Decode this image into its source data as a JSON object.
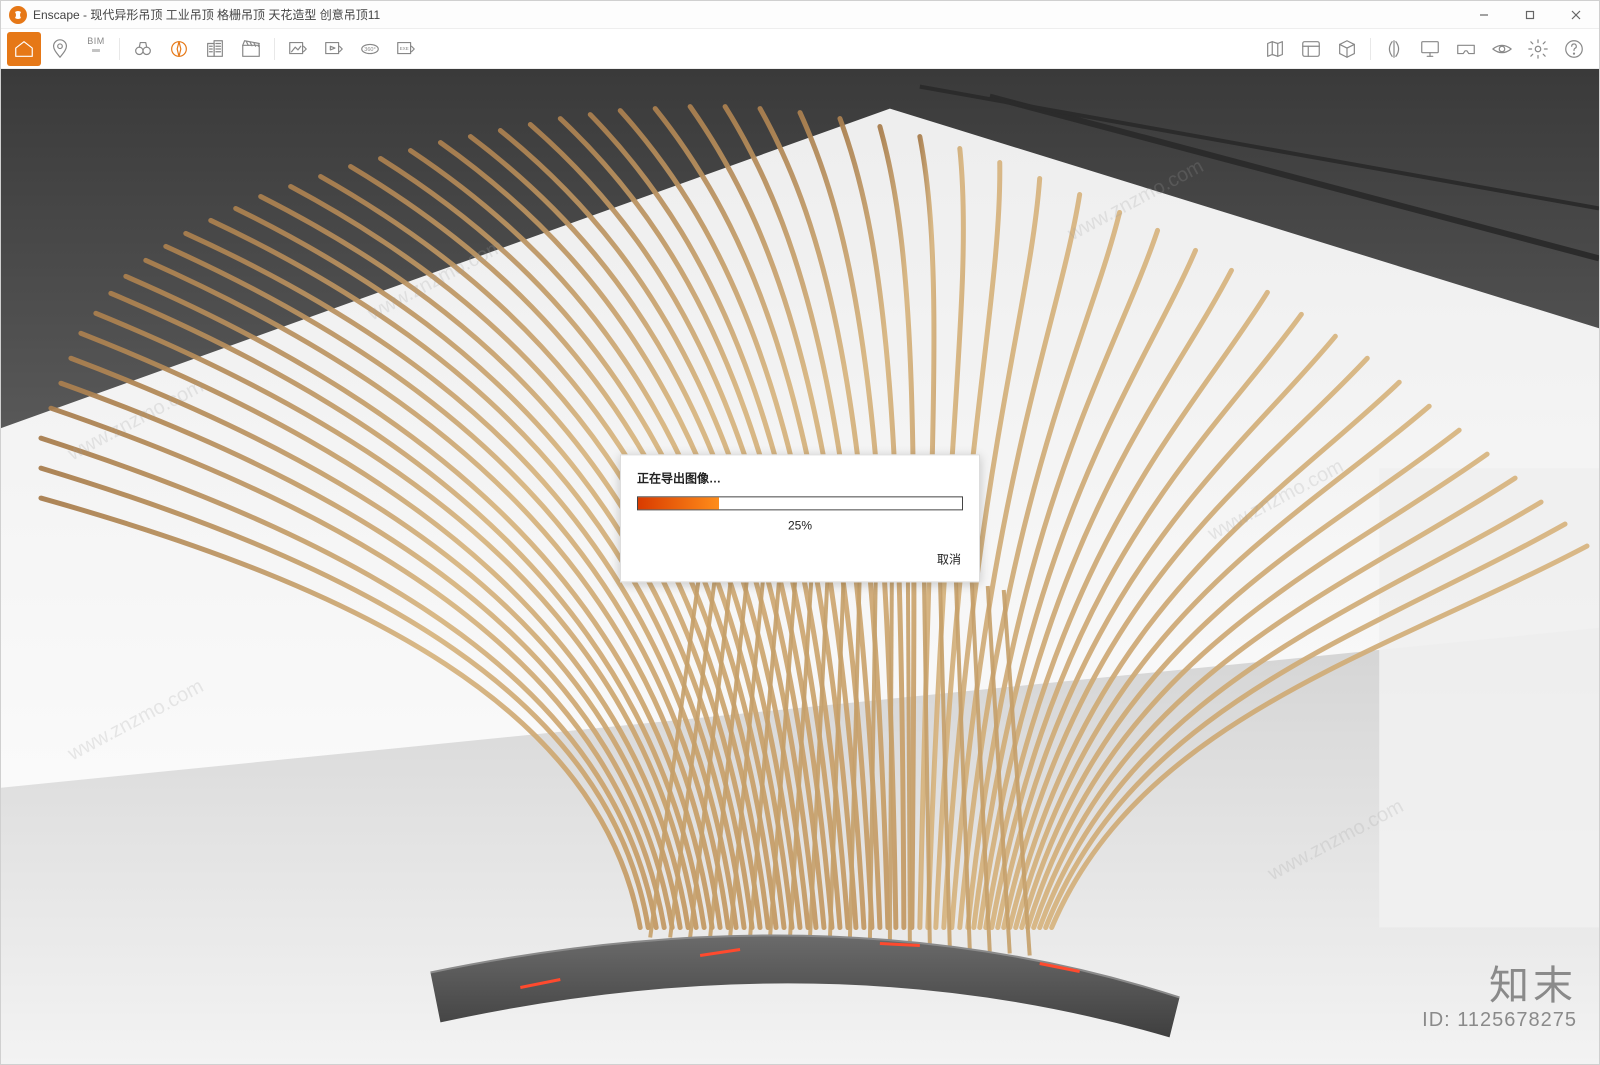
{
  "window": {
    "app_name": "Enscape",
    "title_sep": " - ",
    "document_title": "现代异形吊顶 工业吊顶 格栅吊顶 天花造型 创意吊顶11"
  },
  "toolbar": {
    "bim_label": "BIM"
  },
  "dialog": {
    "title": "正在导出图像…",
    "percent_value": 25,
    "percent_label": "25%",
    "cancel_label": "取消"
  },
  "watermark": {
    "brand": "知末",
    "id_label": "ID: 1125678275",
    "diag_text": "www.znzmo.com"
  },
  "colors": {
    "accent": "#e67817"
  }
}
